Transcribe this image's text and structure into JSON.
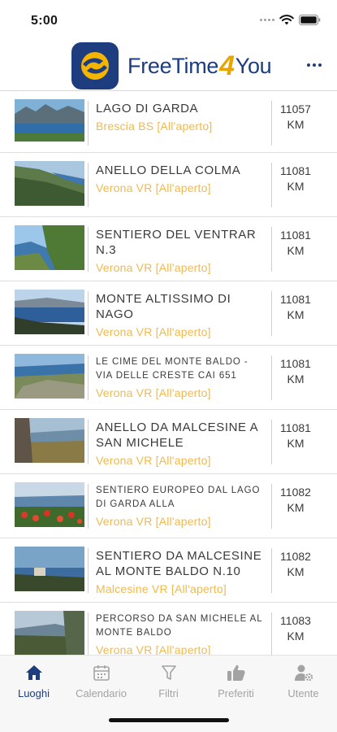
{
  "status_bar": {
    "time": "5:00"
  },
  "header": {
    "brand_left": "FreeTime",
    "brand_mid": "4",
    "brand_right": "You",
    "more_icon": "ellipsis-icon"
  },
  "list": [
    {
      "title": "LAGO DI GARDA",
      "subtitle": "Brescia BS [All'aperto]",
      "distance": "11057",
      "unit": "KM"
    },
    {
      "title": "ANELLO DELLA COLMA",
      "subtitle": "Verona VR [All'aperto]",
      "distance": "11081",
      "unit": "KM"
    },
    {
      "title": "SENTIERO DEL VENTRAR N.3",
      "subtitle": "Verona VR [All'aperto]",
      "distance": "11081",
      "unit": "KM"
    },
    {
      "title": "MONTE ALTISSIMO DI NAGO",
      "subtitle": "Verona VR [All'aperto]",
      "distance": "11081",
      "unit": "KM"
    },
    {
      "title": "LE CIME DEL MONTE BALDO - VIA DELLE CRESTE CAI 651",
      "subtitle": "Verona VR [All'aperto]",
      "distance": "11081",
      "unit": "KM"
    },
    {
      "title": "ANELLO DA MALCESINE A SAN MICHELE",
      "subtitle": "Verona VR [All'aperto]",
      "distance": "11081",
      "unit": "KM"
    },
    {
      "title": "SENTIERO EUROPEO DAL LAGO DI GARDA ALLA",
      "subtitle": "Verona VR [All'aperto]",
      "distance": "11082",
      "unit": "KM"
    },
    {
      "title": "SENTIERO DA MALCESINE AL MONTE BALDO N.10",
      "subtitle": "Malcesine VR [All'aperto]",
      "distance": "11082",
      "unit": "KM"
    },
    {
      "title": "PERCORSO DA SAN MICHELE AL MONTE BALDO",
      "subtitle": "Verona VR [All'aperto]",
      "distance": "11083",
      "unit": "KM"
    }
  ],
  "nav": [
    {
      "label": "Luoghi",
      "icon": "home-icon"
    },
    {
      "label": "Calendario",
      "icon": "calendar-icon"
    },
    {
      "label": "Filtri",
      "icon": "filter-icon"
    },
    {
      "label": "Preferiti",
      "icon": "thumbs-up-icon"
    },
    {
      "label": "Utente",
      "icon": "user-settings-icon"
    }
  ],
  "colors": {
    "brand": "#1d3d7e",
    "accent": "#f2b94a",
    "logo_four": "#e8a500"
  }
}
